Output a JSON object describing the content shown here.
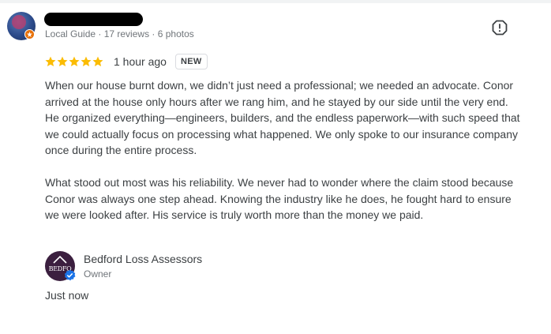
{
  "reviewer": {
    "meta": "Local Guide · 17 reviews · 6 photos"
  },
  "review": {
    "rating": 5,
    "max_rating": 5,
    "time": "1 hour ago",
    "badge": "NEW",
    "paragraphs": [
      "When our house burnt down, we didn’t just need a professional; we needed an advocate. Conor arrived at the house only hours after we rang him, and he stayed by our side until the very end. He organized everything—engineers, builders, and the endless paperwork—with such speed that we could actually focus on processing what happened. We only spoke to our insurance company once during the entire process.",
      "What stood out most was his reliability. We never had to wonder where the claim stood because Conor was always one step ahead. Knowing the industry like he does, he fought hard to ensure we were looked after. His service is truly worth more than the money we paid."
    ]
  },
  "owner_reply": {
    "name": "Bedford Loss Assessors",
    "role": "Owner",
    "avatar_text": "BEDFO",
    "time": "Just now"
  },
  "colors": {
    "star": "#fbbc04",
    "text": "#3c4043",
    "muted": "#70757a",
    "guide_badge": "#e8710a",
    "verified": "#1a73e8"
  },
  "icons": {
    "flag": "report-flag-icon",
    "star": "star-icon",
    "verified": "verified-check-icon",
    "guide": "local-guide-badge-icon"
  }
}
